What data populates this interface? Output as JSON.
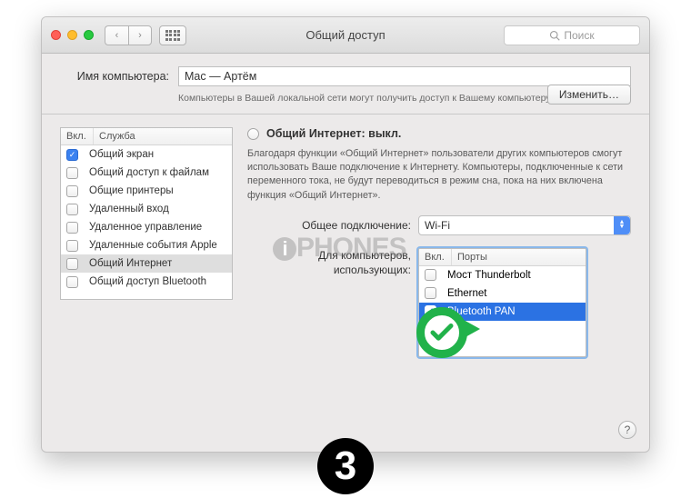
{
  "window": {
    "title": "Общий доступ"
  },
  "search": {
    "placeholder": "Поиск"
  },
  "toolbar": {
    "back": "‹",
    "forward": "›"
  },
  "computer_name": {
    "label": "Имя компьютера:",
    "value": "Mac — Артём",
    "hint": "Компьютеры в Вашей локальной сети могут получить доступ к Вашему компьютеру: Mac-Artem.local",
    "edit_button": "Изменить…"
  },
  "services": {
    "columns": {
      "enabled": "Вкл.",
      "service": "Служба"
    },
    "items": [
      {
        "enabled": true,
        "label": "Общий экран"
      },
      {
        "enabled": false,
        "label": "Общий доступ к файлам"
      },
      {
        "enabled": false,
        "label": "Общие принтеры"
      },
      {
        "enabled": false,
        "label": "Удаленный вход"
      },
      {
        "enabled": false,
        "label": "Удаленное управление"
      },
      {
        "enabled": false,
        "label": "Удаленные события Apple"
      },
      {
        "enabled": false,
        "label": "Общий Интернет",
        "selected": true
      },
      {
        "enabled": false,
        "label": "Общий доступ Bluetooth"
      }
    ]
  },
  "internet_sharing": {
    "title": "Общий Интернет: выкл.",
    "description": "Благодаря функции «Общий Интернет» пользователи других компьютеров смогут использовать Ваше подключение к Интернету. Компьютеры, подключенные к сети переменного тока, не будут переводиться в режим сна, пока на них включена функция «Общий Интернет».",
    "share_from_label": "Общее подключение:",
    "share_from_value": "Wi-Fi",
    "share_to_label": "Для компьютеров, использующих:",
    "ports": {
      "columns": {
        "enabled": "Вкл.",
        "port": "Порты"
      },
      "items": [
        {
          "enabled": false,
          "label": "Мост Thunderbolt"
        },
        {
          "enabled": false,
          "label": "Ethernet"
        },
        {
          "enabled": true,
          "label": "Bluetooth PAN",
          "selected": true
        }
      ]
    }
  },
  "overlay": {
    "step_number": "3",
    "watermark_text": "PHONES"
  },
  "colors": {
    "accent": "#2b72e3",
    "green": "#21b24a"
  }
}
